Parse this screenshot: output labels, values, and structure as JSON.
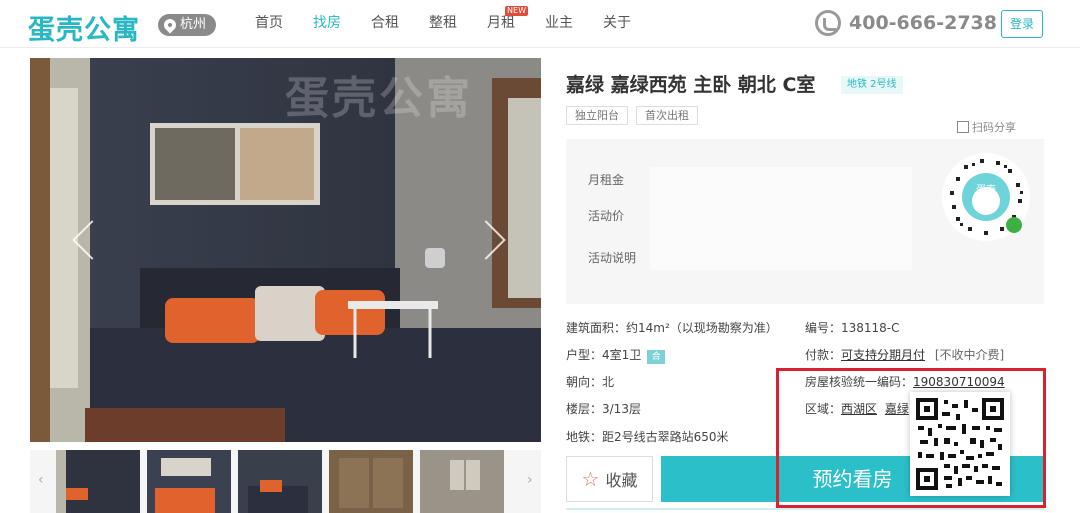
{
  "header": {
    "logo": "蛋壳公寓",
    "city": "杭州",
    "nav": [
      {
        "label": "首页"
      },
      {
        "label": "找房"
      },
      {
        "label": "合租"
      },
      {
        "label": "整租"
      },
      {
        "label": "月租",
        "badge": "NEW"
      },
      {
        "label": "业主"
      },
      {
        "label": "关于"
      }
    ],
    "phone": "400-666-2738",
    "login": "登录"
  },
  "gallery": {
    "watermark": "蛋壳公寓"
  },
  "listing": {
    "title": "嘉绿 嘉绿西苑 主卧 朝北 C室",
    "metro_tag": "地铁 2号线",
    "tags": [
      "独立阳台",
      "首次出租"
    ],
    "share": "扫码分享",
    "price": {
      "rent_label": "月租金",
      "promo_label": "活动价",
      "promo_desc_label": "活动说明"
    },
    "details": {
      "area": "建筑面积：约14m²（以现场勘察为准）",
      "layout_label": "户型：4室1卫",
      "layout_badge": "合",
      "orientation": "朝向：北",
      "floor": "楼层：3/13层",
      "metro": "地铁：距2号线古翠路站650米",
      "code_label": "编号：138118-C",
      "pay_label": "付款：",
      "pay_link": "可支持分期月付",
      "pay_note": "[不收中介费]",
      "verify_label": "房屋核验统一编码：",
      "verify_code": "190830710094",
      "region_label": "区域：",
      "region_district": "西湖区",
      "region_area": "嘉绿"
    },
    "favorite": "收藏",
    "book": "预约看房"
  },
  "colors": {
    "accent": "#2bbfc9",
    "highlight": "#d6232f"
  }
}
